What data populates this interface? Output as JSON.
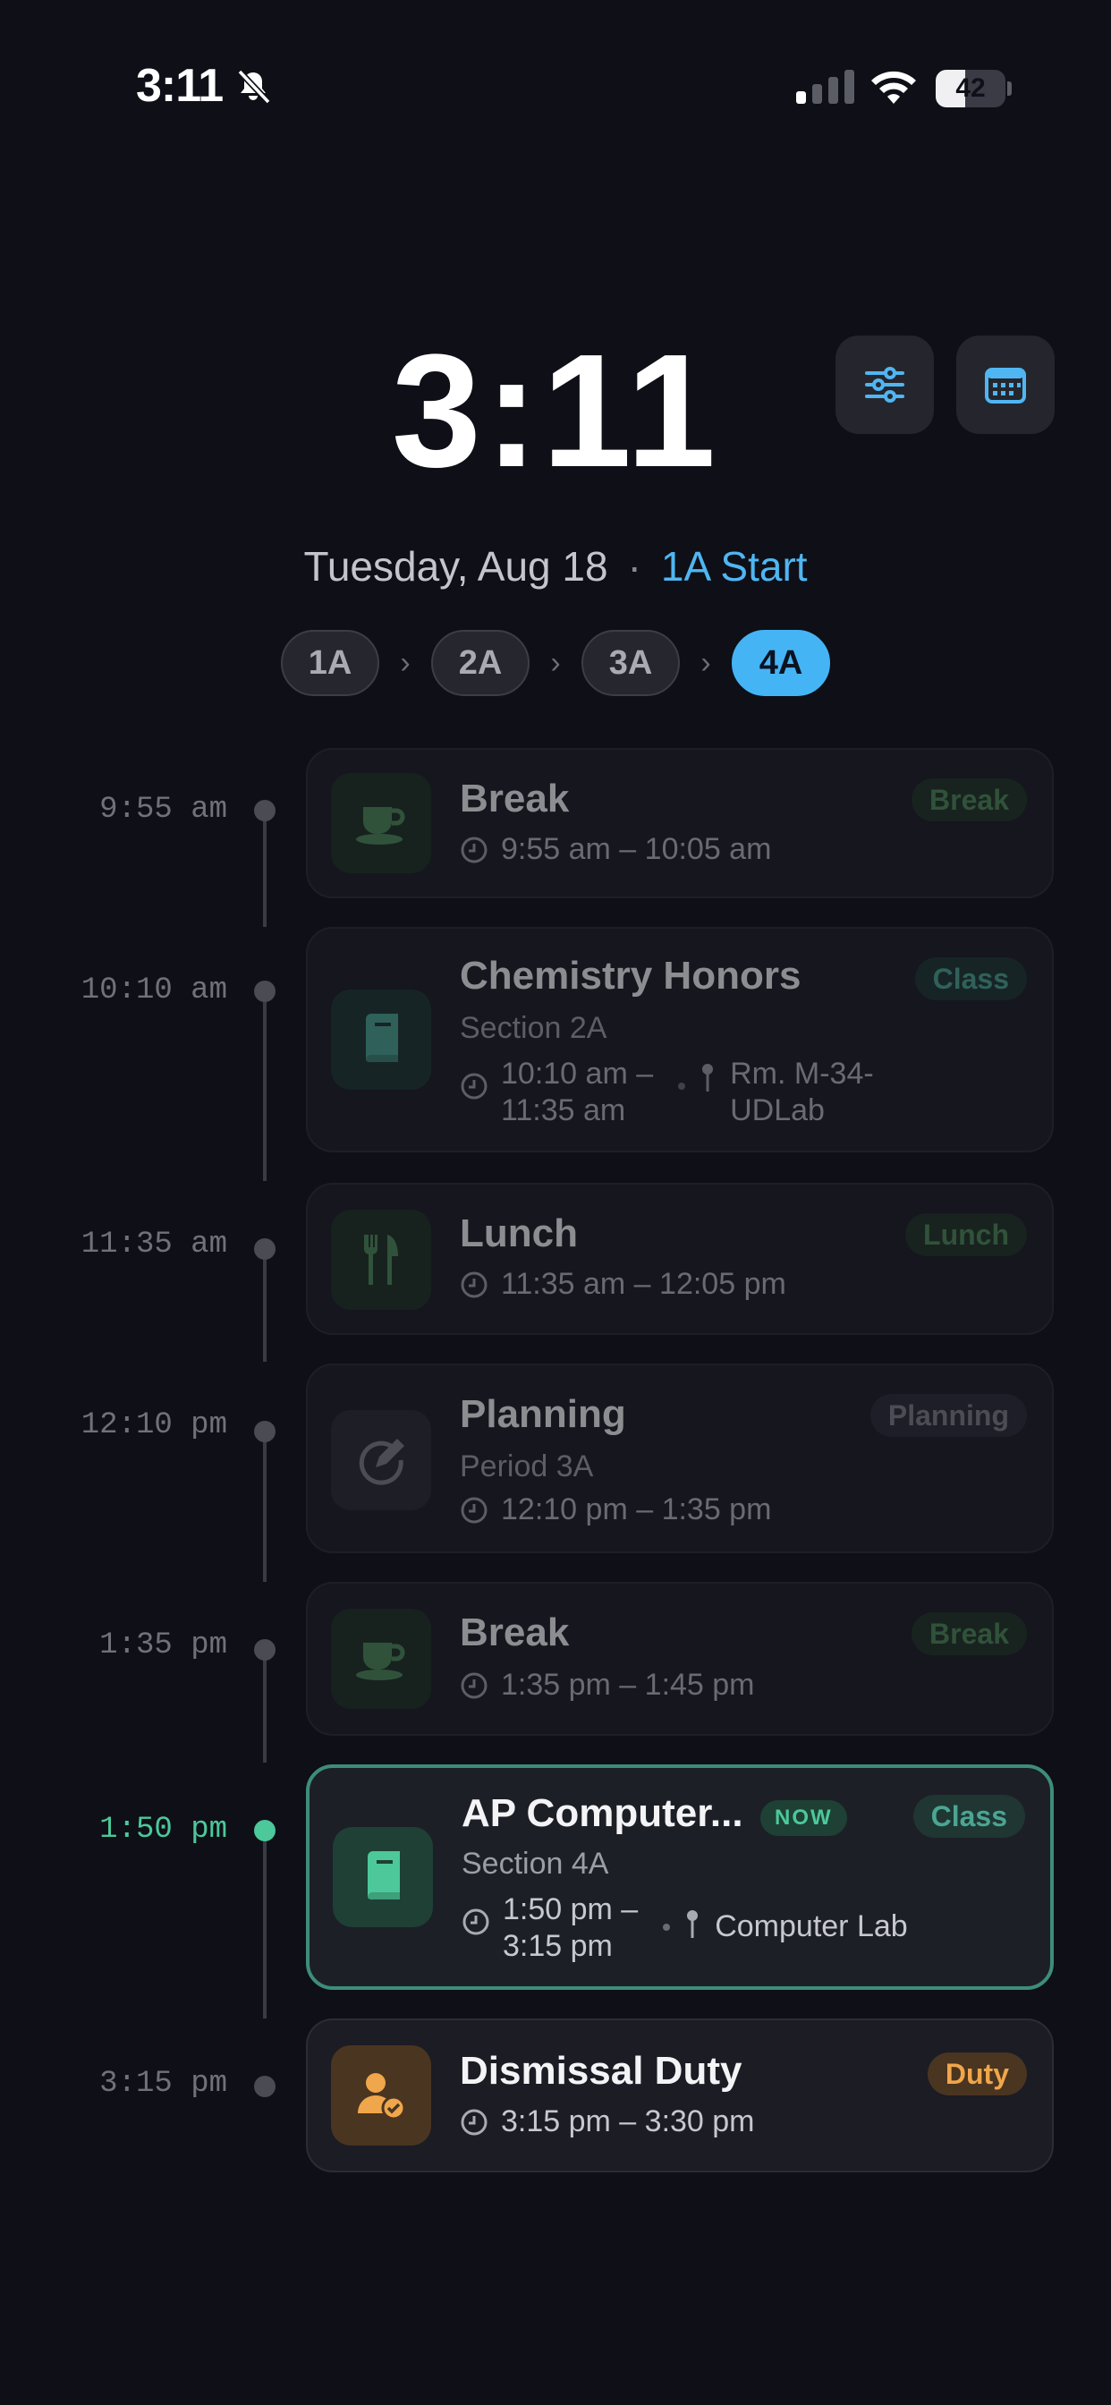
{
  "status_bar": {
    "time": "3:11",
    "battery": "42",
    "battery_level": 0.42
  },
  "header": {
    "clock": "3:11",
    "date": "Tuesday, Aug 18",
    "separator": "·",
    "rotation_start": "1A Start",
    "filter_button_icon": "sliders-icon",
    "calendar_button_icon": "calendar-icon"
  },
  "rotation": {
    "pills": [
      "1A",
      "2A",
      "3A",
      "4A"
    ],
    "active": "4A",
    "chevron": "›"
  },
  "schedule": [
    {
      "time": "9:55 am",
      "title": "Break",
      "badge": "Break",
      "time_range": "9:55 am – 10:05 am",
      "icon": "coffee-cup-icon"
    },
    {
      "time": "10:10 am",
      "title": "Chemistry Honors",
      "badge": "Class",
      "subtitle": "Section 2A",
      "time_range_line1": "10:10 am –",
      "time_range_line2": "11:35 am",
      "location_line1": "Rm. M-34-",
      "location_line2": "UDLab",
      "icon": "book-icon"
    },
    {
      "time": "11:35 am",
      "title": "Lunch",
      "badge": "Lunch",
      "time_range": "11:35 am – 12:05 pm",
      "icon": "fork-knife-icon"
    },
    {
      "time": "12:10 pm",
      "title": "Planning",
      "badge": "Planning",
      "subtitle": "Period 3A",
      "time_range": "12:10 pm – 1:35 pm",
      "icon": "pencil-circle-icon"
    },
    {
      "time": "1:35 pm",
      "title": "Break",
      "badge": "Break",
      "time_range": "1:35 pm – 1:45 pm",
      "icon": "coffee-cup-icon"
    },
    {
      "time": "1:50 pm",
      "title": "AP Computer...",
      "now_label": "NOW",
      "badge": "Class",
      "subtitle": "Section 4A",
      "time_range_line1": "1:50 pm –",
      "time_range_line2": "3:15 pm",
      "location": "Computer Lab",
      "icon": "book-icon"
    },
    {
      "time": "3:15 pm",
      "title": "Dismissal Duty",
      "badge": "Duty",
      "time_range": "3:15 pm – 3:30 pm",
      "icon": "person-check-icon"
    }
  ],
  "colors": {
    "background": "#0e0f17",
    "accent_blue": "#45b4f5",
    "now_green": "#4cc89a",
    "duty_orange": "#f0a64b"
  }
}
